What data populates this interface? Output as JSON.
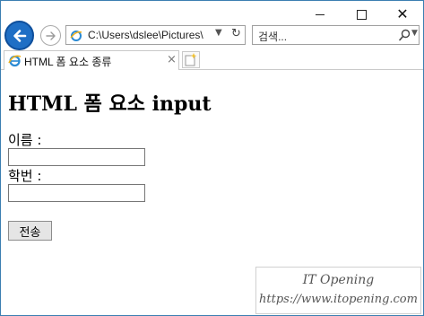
{
  "window": {
    "minimize_icon": "minimize-icon",
    "maximize_icon": "maximize-icon",
    "close_glyph": "✕"
  },
  "nav": {
    "address_text": "C:\\Users\\dslee\\Pictures\\",
    "search_placeholder": "검색..."
  },
  "tab": {
    "title": "HTML 폼 요소 종류",
    "close_glyph": "×"
  },
  "page": {
    "heading": "HTML 폼 요소 input",
    "name_label": "이름 :",
    "name_value": "",
    "id_label": "학번 :",
    "id_value": "",
    "submit_label": "전송"
  },
  "watermark": {
    "line1": "IT Opening",
    "line2": "https://www.itopening.com"
  },
  "colors": {
    "back_button": "#1f6fc5",
    "window_border": "#3c7fb1"
  }
}
